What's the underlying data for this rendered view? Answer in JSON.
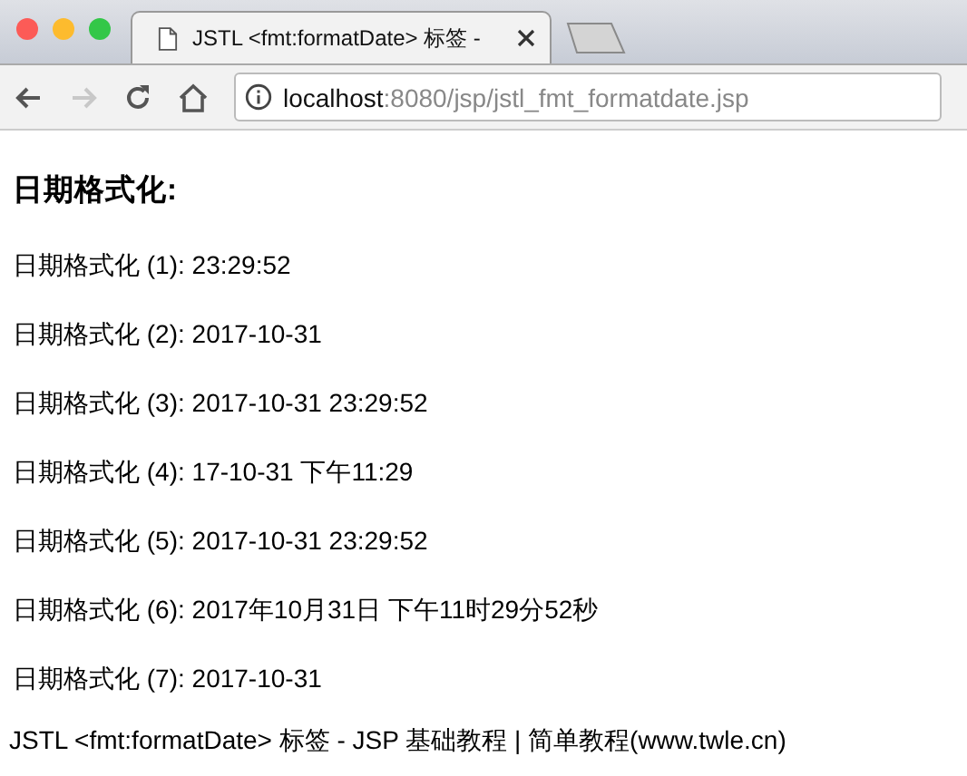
{
  "tab": {
    "title": "JSTL <fmt:formatDate> 标签 -",
    "selected": true
  },
  "address_bar": {
    "host": "localhost",
    "path": ":8080/jsp/jstl_fmt_formatdate.jsp"
  },
  "heading": "日期格式化:",
  "lines": [
    "日期格式化 (1): 23:29:52",
    "日期格式化 (2): 2017-10-31",
    "日期格式化 (3): 2017-10-31 23:29:52",
    "日期格式化 (4): 17-10-31 下午11:29",
    "日期格式化 (5): 2017-10-31 23:29:52",
    "日期格式化 (6): 2017年10月31日 下午11时29分52秒",
    "日期格式化 (7): 2017-10-31"
  ],
  "footer": "JSTL <fmt:formatDate> 标签 - JSP 基础教程 | 简单教程(www.twle.cn)"
}
